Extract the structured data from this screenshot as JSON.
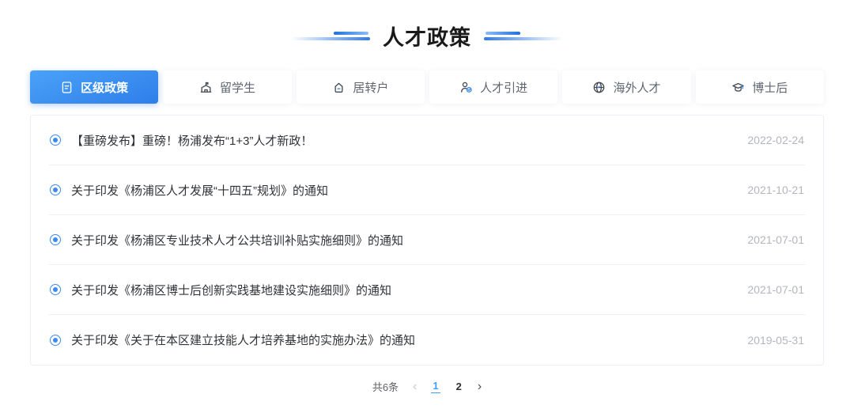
{
  "header": {
    "title": "人才政策"
  },
  "tabs": [
    {
      "label": "区级政策",
      "icon": "document-icon",
      "active": true
    },
    {
      "label": "留学生",
      "icon": "school-icon",
      "active": false
    },
    {
      "label": "居转户",
      "icon": "house-icon",
      "active": false
    },
    {
      "label": "人才引进",
      "icon": "person-check-icon",
      "active": false
    },
    {
      "label": "海外人才",
      "icon": "globe-plane-icon",
      "active": false
    },
    {
      "label": "博士后",
      "icon": "graduation-cap-icon",
      "active": false
    }
  ],
  "policy_list": [
    {
      "title": "【重磅发布】重磅！杨浦发布“1+3”人才新政！",
      "date": "2022-02-24"
    },
    {
      "title": "关于印发《杨浦区人才发展“十四五”规划》的通知",
      "date": "2021-10-21"
    },
    {
      "title": "关于印发《杨浦区专业技术人才公共培训补贴实施细则》的通知",
      "date": "2021-07-01"
    },
    {
      "title": "关于印发《杨浦区博士后创新实践基地建设实施细则》的通知",
      "date": "2021-07-01"
    },
    {
      "title": "关于印发《关于在本区建立技能人才培养基地的实施办法》的通知",
      "date": "2019-05-31"
    }
  ],
  "pagination": {
    "total_label": "共6条",
    "prev_icon": "‹",
    "next_icon": "›",
    "pages": [
      {
        "label": "1",
        "current": true
      },
      {
        "label": "2",
        "current": false
      }
    ]
  },
  "colors": {
    "accent_blue": "#3a8bf0",
    "active_tab_gradient_start": "#4ba2f8",
    "active_tab_gradient_end": "#2e7ee9",
    "current_page_blue": "#409eff",
    "date_gray": "#b3b7bd"
  }
}
